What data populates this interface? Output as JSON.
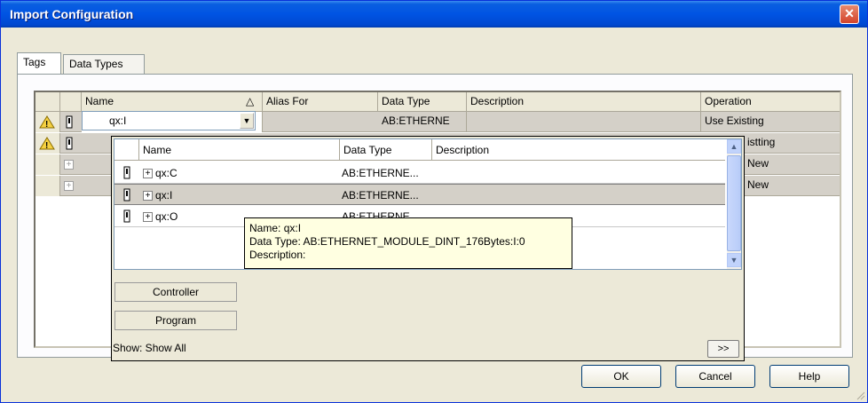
{
  "window": {
    "title": "Import Configuration",
    "close_glyph": "✕"
  },
  "tabs": [
    {
      "label": "Tags",
      "active": true
    },
    {
      "label": "Data Types",
      "active": false
    }
  ],
  "grid": {
    "columns": {
      "name": "Name",
      "sort_glyph": "△",
      "alias_for": "Alias For",
      "data_type": "Data Type",
      "description": "Description",
      "operation": "Operation"
    },
    "rows": [
      {
        "name": "qx:I",
        "data_type": "AB:ETHERNE",
        "operation": "Use Existing",
        "warning": true
      },
      {
        "name": "",
        "data_type": "",
        "operation": "istting",
        "warning": true
      },
      {
        "name": "",
        "data_type": "",
        "operation": "New",
        "warning": false
      },
      {
        "name": "",
        "data_type": "",
        "operation": "New",
        "warning": false
      }
    ]
  },
  "dropdown": {
    "columns": {
      "name": "Name",
      "data_type": "Data Type",
      "description": "Description"
    },
    "items": [
      {
        "name": "qx:C",
        "data_type": "AB:ETHERNE...",
        "selected": false
      },
      {
        "name": "qx:I",
        "data_type": "AB:ETHERNE...",
        "selected": true
      },
      {
        "name": "qx:O",
        "data_type": "AB:ETHERNE...",
        "selected": false
      }
    ],
    "tooltip": {
      "name_label": "Name:",
      "name_value": "qx:I",
      "type_label": "Data Type:",
      "type_value": "AB:ETHERNET_MODULE_DINT_176Bytes:I:0",
      "desc_label": "Description:"
    },
    "scope_buttons": {
      "controller": "Controller",
      "program": "Program"
    },
    "show_label": "Show: Show All",
    "more_label": ">>"
  },
  "buttons": {
    "ok": "OK",
    "cancel": "Cancel",
    "help": "Help"
  },
  "icons": {
    "warning": "warning-icon",
    "module": "module-icon",
    "expand": "expand-plus-icon",
    "combo_arrow": "chevron-down-icon"
  },
  "colors": {
    "titlebar": "#0054e3",
    "dialog_bg": "#ece9d8",
    "tooltip_bg": "#ffffe1"
  }
}
